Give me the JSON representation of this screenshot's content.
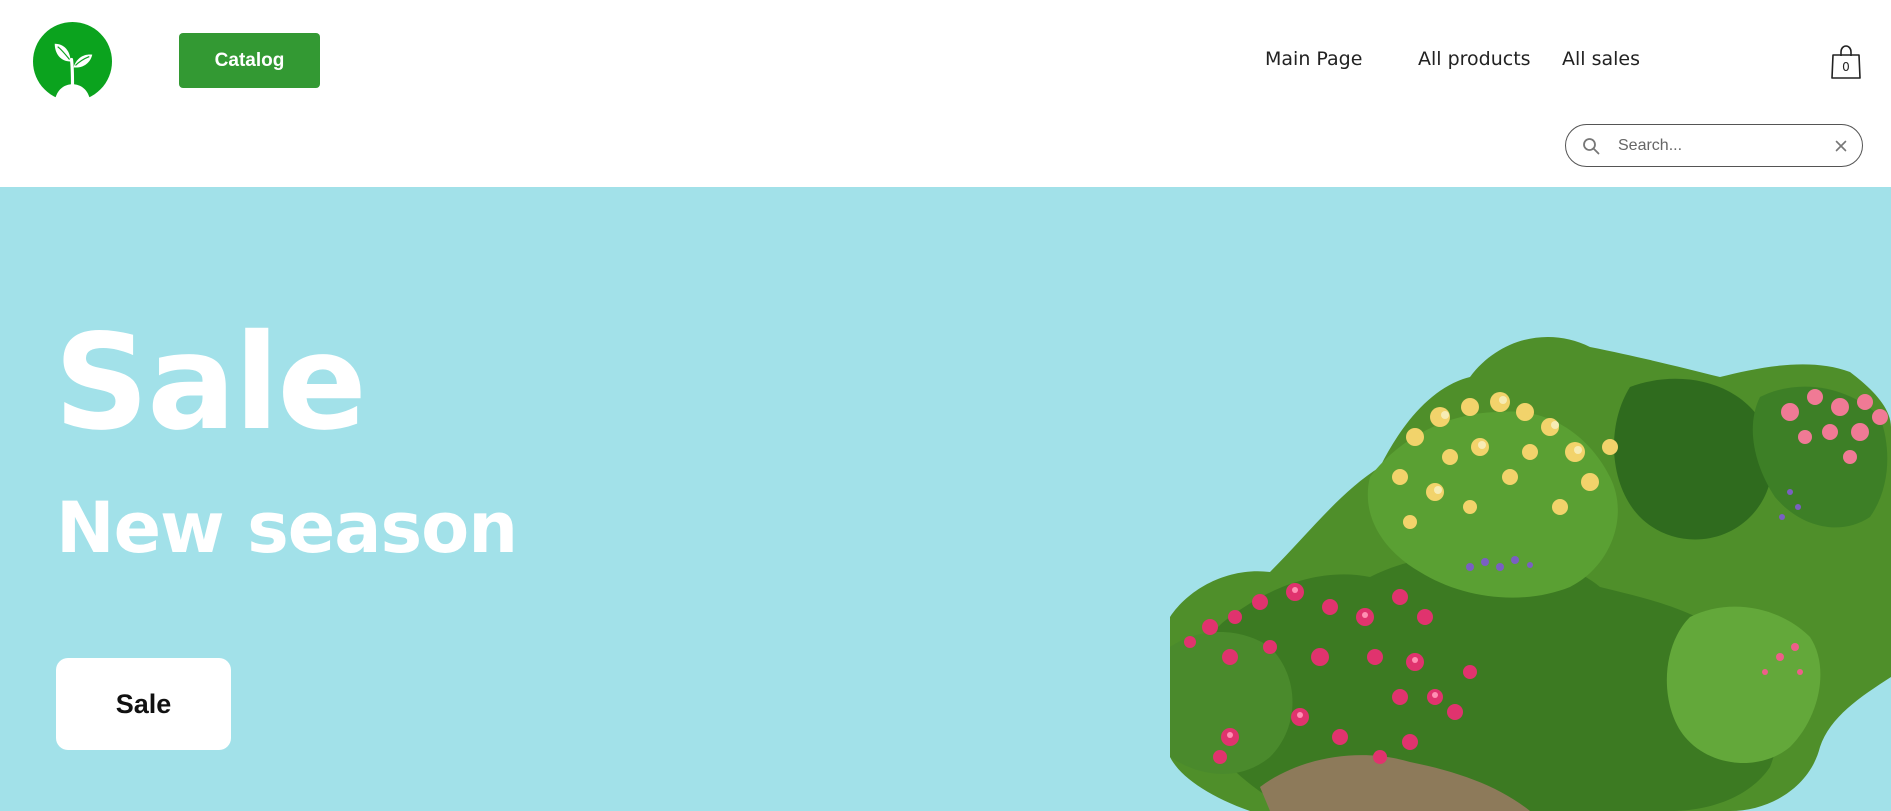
{
  "header": {
    "logo_icon": "sprout-leaf-icon",
    "brand_color": "#0ba31e",
    "catalog_label": "Catalog",
    "catalog_color": "#339933",
    "nav": [
      {
        "label": "Main Page"
      },
      {
        "label": "All products"
      },
      {
        "label": "All sales"
      }
    ],
    "cart": {
      "icon": "shopping-bag-icon",
      "count": "0"
    },
    "search": {
      "placeholder": "Search...",
      "value": "",
      "icon": "search-icon",
      "clear_icon": "close-icon"
    }
  },
  "hero": {
    "background": "#a2e1e9",
    "title": "Sale",
    "subtitle": "New season",
    "button_label": "Sale",
    "image": "flower-garden-image"
  }
}
